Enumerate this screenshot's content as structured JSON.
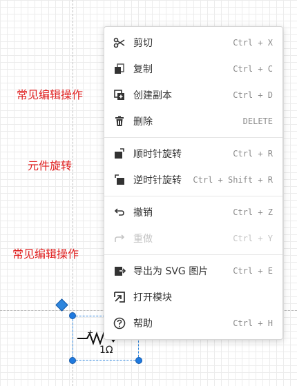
{
  "annotations": [
    "常见编辑操作",
    "元件旋转",
    "常见编辑操作"
  ],
  "component": {
    "label": "1Ω",
    "plus": "+"
  },
  "menu": {
    "groups": [
      [
        {
          "icon": "scissors-icon",
          "label": "剪切",
          "shortcut": "Ctrl + X",
          "disabled": false
        },
        {
          "icon": "copy-icon",
          "label": "复制",
          "shortcut": "Ctrl + C",
          "disabled": false
        },
        {
          "icon": "duplicate-icon",
          "label": "创建副本",
          "shortcut": "Ctrl + D",
          "disabled": false
        },
        {
          "icon": "trash-icon",
          "label": "删除",
          "shortcut": "DELETE",
          "disabled": false
        }
      ],
      [
        {
          "icon": "rotate-clockwise-icon",
          "label": "顺时针旋转",
          "shortcut": "Ctrl + R",
          "disabled": false
        },
        {
          "icon": "rotate-counterclockwise-icon",
          "label": "逆时针旋转",
          "shortcut": "Ctrl + Shift + R",
          "disabled": false
        }
      ],
      [
        {
          "icon": "undo-icon",
          "label": "撤销",
          "shortcut": "Ctrl + Z",
          "disabled": false
        },
        {
          "icon": "redo-icon",
          "label": "重做",
          "shortcut": "Ctrl + Y",
          "disabled": true
        }
      ],
      [
        {
          "icon": "export-icon",
          "label": "导出为 SVG 图片",
          "shortcut": "Ctrl + E",
          "disabled": false
        },
        {
          "icon": "open-module-icon",
          "label": "打开模块",
          "shortcut": "",
          "disabled": false
        },
        {
          "icon": "help-icon",
          "label": "帮助",
          "shortcut": "Ctrl + H",
          "disabled": false
        }
      ]
    ]
  }
}
